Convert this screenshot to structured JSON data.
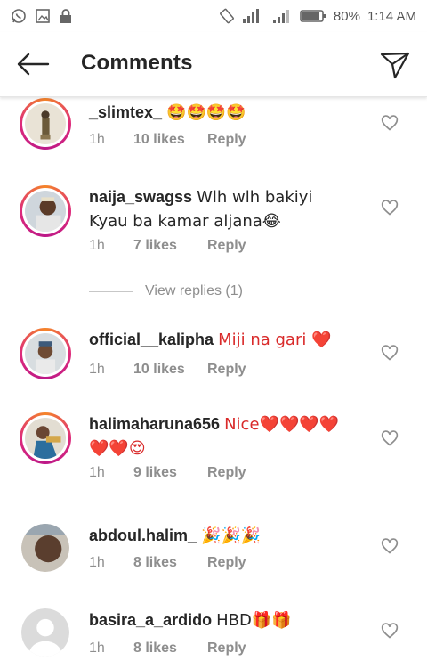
{
  "status_bar": {
    "battery": "80%",
    "time": "1:14 AM"
  },
  "header": {
    "title": "Comments"
  },
  "comments": [
    {
      "user": "_slimtex_",
      "text": "🤩🤩🤩🤩",
      "time": "1h",
      "likes": "10 likes",
      "reply": "Reply"
    },
    {
      "user": "naija_swagss",
      "text": "Wlh wlh bakiyi Kyau ba kamar aljana😂",
      "time": "1h",
      "likes": "7 likes",
      "reply": "Reply"
    },
    {
      "user": "official__kalipha",
      "text": "Miji na gari ❤️",
      "time": "1h",
      "likes": "10 likes",
      "reply": "Reply"
    },
    {
      "user": "halimaharuna656",
      "text": "Nice❤️❤️❤️❤️❤️❤️😍",
      "time": "1h",
      "likes": "9 likes",
      "reply": "Reply"
    },
    {
      "user": "abdoul.halim_",
      "text": "🎉🎉🎉",
      "time": "1h",
      "likes": "8 likes",
      "reply": "Reply"
    },
    {
      "user": "basira_a_ardido",
      "text": "HBD🎁🎁",
      "time": "1h",
      "likes": "8 likes",
      "reply": "Reply"
    }
  ],
  "view_replies": "View replies (1)",
  "icons": {
    "back": "arrow-left-icon",
    "share": "paper-plane-icon",
    "like": "heart-outline-icon"
  },
  "colors": {
    "story_ring": "#dd2a7b",
    "meta_gray": "#8e8e8e",
    "heart_red": "#d92a2a"
  }
}
